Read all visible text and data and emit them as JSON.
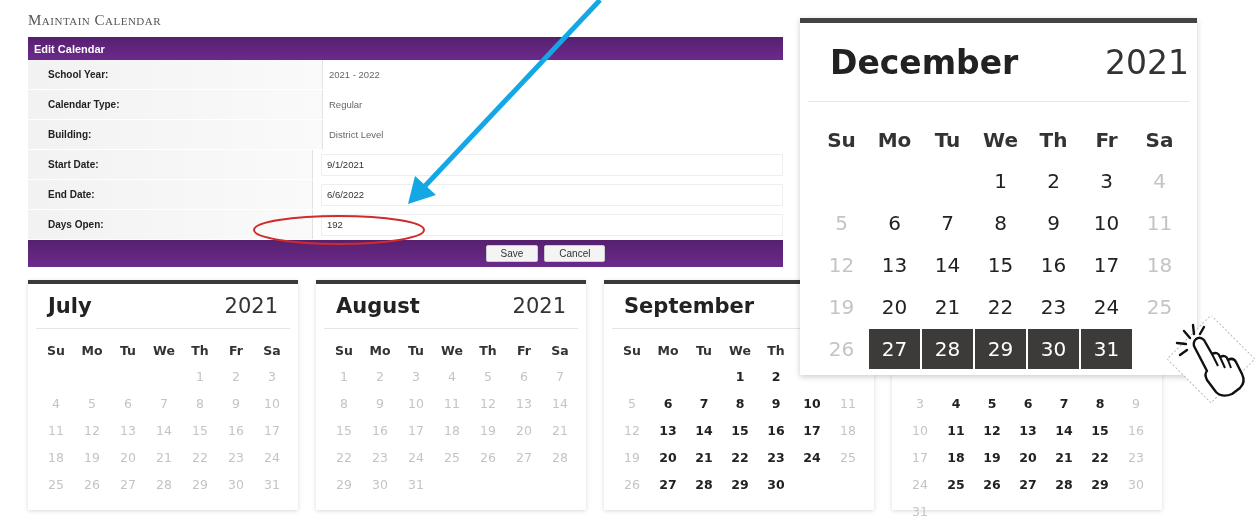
{
  "page_title": "Maintain Calendar",
  "form": {
    "title": "Edit Calendar",
    "rows": [
      {
        "label": "School Year:",
        "value": "2021 - 2022",
        "kind": "text"
      },
      {
        "label": "Calendar Type:",
        "value": "Regular",
        "kind": "text"
      },
      {
        "label": "Building:",
        "value": "District Level",
        "kind": "text"
      },
      {
        "label": "Start Date:",
        "value": "9/1/2021",
        "kind": "input"
      },
      {
        "label": "End Date:",
        "value": "6/6/2022",
        "kind": "input"
      },
      {
        "label": "Days Open:",
        "value": "192",
        "kind": "input"
      }
    ],
    "buttons": [
      "Save",
      "Cancel"
    ]
  },
  "calendars": [
    {
      "month": "July",
      "year": "2021",
      "weekdays": [
        "Su",
        "Mo",
        "Tu",
        "We",
        "Th",
        "Fr",
        "Sa"
      ],
      "weeks": [
        [
          {
            "day": "1",
            "open": false,
            "selected": false
          },
          {
            "day": "2",
            "open": false,
            "selected": false
          },
          {
            "day": "3",
            "open": false,
            "selected": false
          }
        ],
        [
          {
            "day": "4",
            "open": false,
            "selected": false
          },
          {
            "day": "5",
            "open": false,
            "selected": false
          },
          {
            "day": "6",
            "open": false,
            "selected": false
          },
          {
            "day": "7",
            "open": false,
            "selected": false
          },
          {
            "day": "8",
            "open": false,
            "selected": false
          },
          {
            "day": "9",
            "open": false,
            "selected": false
          },
          {
            "day": "10",
            "open": false,
            "selected": false
          }
        ],
        [
          {
            "day": "11",
            "open": false,
            "selected": false
          },
          {
            "day": "12",
            "open": false,
            "selected": false
          },
          {
            "day": "13",
            "open": false,
            "selected": false
          },
          {
            "day": "14",
            "open": false,
            "selected": false
          },
          {
            "day": "15",
            "open": false,
            "selected": false
          },
          {
            "day": "16",
            "open": false,
            "selected": false
          },
          {
            "day": "17",
            "open": false,
            "selected": false
          }
        ],
        [
          {
            "day": "18",
            "open": false,
            "selected": false
          },
          {
            "day": "19",
            "open": false,
            "selected": false
          },
          {
            "day": "20",
            "open": false,
            "selected": false
          },
          {
            "day": "21",
            "open": false,
            "selected": false
          },
          {
            "day": "22",
            "open": false,
            "selected": false
          },
          {
            "day": "23",
            "open": false,
            "selected": false
          },
          {
            "day": "24",
            "open": false,
            "selected": false
          }
        ],
        [
          {
            "day": "25",
            "open": false,
            "selected": false
          },
          {
            "day": "26",
            "open": false,
            "selected": false
          },
          {
            "day": "27",
            "open": false,
            "selected": false
          },
          {
            "day": "28",
            "open": false,
            "selected": false
          },
          {
            "day": "29",
            "open": false,
            "selected": false
          },
          {
            "day": "30",
            "open": false,
            "selected": false
          },
          {
            "day": "31",
            "open": false,
            "selected": false
          }
        ]
      ]
    },
    {
      "month": "August",
      "year": "2021",
      "weekdays": [
        "Su",
        "Mo",
        "Tu",
        "We",
        "Th",
        "Fr",
        "Sa"
      ],
      "weeks": [
        [
          {
            "day": "1",
            "open": false,
            "selected": false
          },
          {
            "day": "2",
            "open": false,
            "selected": false
          },
          {
            "day": "3",
            "open": false,
            "selected": false
          },
          {
            "day": "4",
            "open": false,
            "selected": false
          },
          {
            "day": "5",
            "open": false,
            "selected": false
          },
          {
            "day": "6",
            "open": false,
            "selected": false
          },
          {
            "day": "7",
            "open": false,
            "selected": false
          }
        ],
        [
          {
            "day": "8",
            "open": false,
            "selected": false
          },
          {
            "day": "9",
            "open": false,
            "selected": false
          },
          {
            "day": "10",
            "open": false,
            "selected": false
          },
          {
            "day": "11",
            "open": false,
            "selected": false
          },
          {
            "day": "12",
            "open": false,
            "selected": false
          },
          {
            "day": "13",
            "open": false,
            "selected": false
          },
          {
            "day": "14",
            "open": false,
            "selected": false
          }
        ],
        [
          {
            "day": "15",
            "open": false,
            "selected": false
          },
          {
            "day": "16",
            "open": false,
            "selected": false
          },
          {
            "day": "17",
            "open": false,
            "selected": false
          },
          {
            "day": "18",
            "open": false,
            "selected": false
          },
          {
            "day": "19",
            "open": false,
            "selected": false
          },
          {
            "day": "20",
            "open": false,
            "selected": false
          },
          {
            "day": "21",
            "open": false,
            "selected": false
          }
        ],
        [
          {
            "day": "22",
            "open": false,
            "selected": false
          },
          {
            "day": "23",
            "open": false,
            "selected": false
          },
          {
            "day": "24",
            "open": false,
            "selected": false
          },
          {
            "day": "25",
            "open": false,
            "selected": false
          },
          {
            "day": "26",
            "open": false,
            "selected": false
          },
          {
            "day": "27",
            "open": false,
            "selected": false
          },
          {
            "day": "28",
            "open": false,
            "selected": false
          }
        ],
        [
          {
            "day": "29",
            "open": false,
            "selected": false
          },
          {
            "day": "30",
            "open": false,
            "selected": false
          },
          {
            "day": "31",
            "open": false,
            "selected": false
          }
        ]
      ]
    },
    {
      "month": "September",
      "weekdays": [
        "Su",
        "Mo",
        "Tu",
        "We",
        "Th"
      ],
      "weeks": [
        [
          {
            "day": "1",
            "open": true,
            "selected": false
          },
          {
            "day": "2",
            "open": true,
            "selected": false
          }
        ],
        [
          {
            "day": "5",
            "open": false,
            "selected": false
          },
          {
            "day": "6",
            "open": true,
            "selected": false
          },
          {
            "day": "7",
            "open": true,
            "selected": false
          },
          {
            "day": "8",
            "open": true,
            "selected": false
          },
          {
            "day": "9",
            "open": true,
            "selected": false
          },
          {
            "day": "10",
            "open": true,
            "selected": false
          },
          {
            "day": "11",
            "open": false,
            "selected": false
          }
        ],
        [
          {
            "day": "12",
            "open": false,
            "selected": false
          },
          {
            "day": "13",
            "open": true,
            "selected": false
          },
          {
            "day": "14",
            "open": true,
            "selected": false
          },
          {
            "day": "15",
            "open": true,
            "selected": false
          },
          {
            "day": "16",
            "open": true,
            "selected": false
          },
          {
            "day": "17",
            "open": true,
            "selected": false
          },
          {
            "day": "18",
            "open": false,
            "selected": false
          }
        ],
        [
          {
            "day": "19",
            "open": false,
            "selected": false
          },
          {
            "day": "20",
            "open": true,
            "selected": false
          },
          {
            "day": "21",
            "open": true,
            "selected": false
          },
          {
            "day": "22",
            "open": true,
            "selected": false
          },
          {
            "day": "23",
            "open": true,
            "selected": false
          },
          {
            "day": "24",
            "open": true,
            "selected": false
          },
          {
            "day": "25",
            "open": false,
            "selected": false
          }
        ],
        [
          {
            "day": "26",
            "open": false,
            "selected": false
          },
          {
            "day": "27",
            "open": true,
            "selected": false
          },
          {
            "day": "28",
            "open": true,
            "selected": false
          },
          {
            "day": "29",
            "open": true,
            "selected": false
          },
          {
            "day": "30",
            "open": true,
            "selected": false
          }
        ]
      ]
    },
    {
      "weeks": [
        [
          {
            "day": "3",
            "open": false,
            "selected": false
          },
          {
            "day": "4",
            "open": true,
            "selected": false
          },
          {
            "day": "5",
            "open": true,
            "selected": false
          },
          {
            "day": "6",
            "open": true,
            "selected": false
          },
          {
            "day": "7",
            "open": true,
            "selected": false
          },
          {
            "day": "8",
            "open": true,
            "selected": false
          },
          {
            "day": "9",
            "open": false,
            "selected": false
          }
        ],
        [
          {
            "day": "10",
            "open": false,
            "selected": false
          },
          {
            "day": "11",
            "open": true,
            "selected": false
          },
          {
            "day": "12",
            "open": true,
            "selected": false
          },
          {
            "day": "13",
            "open": true,
            "selected": false
          },
          {
            "day": "14",
            "open": true,
            "selected": false
          },
          {
            "day": "15",
            "open": true,
            "selected": false
          },
          {
            "day": "16",
            "open": false,
            "selected": false
          }
        ],
        [
          {
            "day": "17",
            "open": false,
            "selected": false
          },
          {
            "day": "18",
            "open": true,
            "selected": false
          },
          {
            "day": "19",
            "open": true,
            "selected": false
          },
          {
            "day": "20",
            "open": true,
            "selected": false
          },
          {
            "day": "21",
            "open": true,
            "selected": false
          },
          {
            "day": "22",
            "open": true,
            "selected": false
          },
          {
            "day": "23",
            "open": false,
            "selected": false
          }
        ],
        [
          {
            "day": "24",
            "open": false,
            "selected": false
          },
          {
            "day": "25",
            "open": true,
            "selected": false
          },
          {
            "day": "26",
            "open": true,
            "selected": false
          },
          {
            "day": "27",
            "open": true,
            "selected": false
          },
          {
            "day": "28",
            "open": true,
            "selected": false
          },
          {
            "day": "29",
            "open": true,
            "selected": false
          },
          {
            "day": "30",
            "open": false,
            "selected": false
          }
        ],
        [
          {
            "day": "31",
            "open": false,
            "selected": false
          }
        ]
      ]
    }
  ],
  "popup_calendar": {
    "month": "December",
    "year": "2021",
    "weekdays": [
      "Su",
      "Mo",
      "Tu",
      "We",
      "Th",
      "Fr",
      "Sa"
    ],
    "weeks": [
      [
        {
          "day": "1",
          "open": true,
          "selected": false
        },
        {
          "day": "2",
          "open": true,
          "selected": false
        },
        {
          "day": "3",
          "open": true,
          "selected": false
        },
        {
          "day": "4",
          "open": false,
          "selected": false
        }
      ],
      [
        {
          "day": "5",
          "open": false,
          "selected": false
        },
        {
          "day": "6",
          "open": true,
          "selected": false
        },
        {
          "day": "7",
          "open": true,
          "selected": false
        },
        {
          "day": "8",
          "open": true,
          "selected": false
        },
        {
          "day": "9",
          "open": true,
          "selected": false
        },
        {
          "day": "10",
          "open": true,
          "selected": false
        },
        {
          "day": "11",
          "open": false,
          "selected": false
        }
      ],
      [
        {
          "day": "12",
          "open": false,
          "selected": false
        },
        {
          "day": "13",
          "open": true,
          "selected": false
        },
        {
          "day": "14",
          "open": true,
          "selected": false
        },
        {
          "day": "15",
          "open": true,
          "selected": false
        },
        {
          "day": "16",
          "open": true,
          "selected": false
        },
        {
          "day": "17",
          "open": true,
          "selected": false
        },
        {
          "day": "18",
          "open": false,
          "selected": false
        }
      ],
      [
        {
          "day": "19",
          "open": false,
          "selected": false
        },
        {
          "day": "20",
          "open": true,
          "selected": false
        },
        {
          "day": "21",
          "open": true,
          "selected": false
        },
        {
          "day": "22",
          "open": true,
          "selected": false
        },
        {
          "day": "23",
          "open": true,
          "selected": false
        },
        {
          "day": "24",
          "open": true,
          "selected": false
        },
        {
          "day": "25",
          "open": false,
          "selected": false
        }
      ],
      [
        {
          "day": "26",
          "open": false,
          "selected": false
        },
        {
          "day": "27",
          "open": true,
          "selected": true
        },
        {
          "day": "28",
          "open": true,
          "selected": true
        },
        {
          "day": "29",
          "open": true,
          "selected": true
        },
        {
          "day": "30",
          "open": true,
          "selected": true
        },
        {
          "day": "31",
          "open": true,
          "selected": true
        }
      ]
    ]
  }
}
